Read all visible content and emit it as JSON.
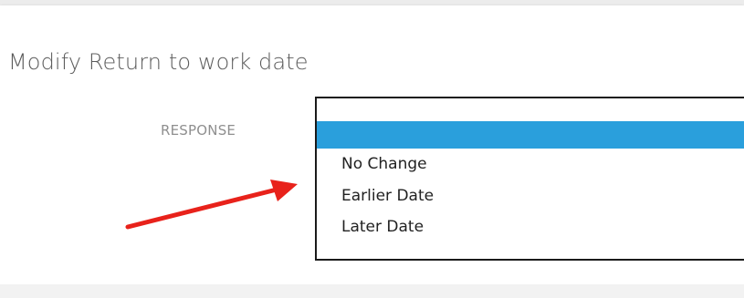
{
  "dialog": {
    "title": "Modify Return to work date"
  },
  "response_field": {
    "label": "RESPONSE",
    "options": [
      {
        "label": ""
      },
      {
        "label": "No Change"
      },
      {
        "label": "Earlier Date"
      },
      {
        "label": "Later Date"
      }
    ],
    "selected_index": 0
  },
  "annotation": {
    "arrow_color": "#e8221b"
  },
  "colors": {
    "selection": "#2a9fdc",
    "title_text": "#5c5c5c",
    "label_text": "#8f8f8f"
  }
}
